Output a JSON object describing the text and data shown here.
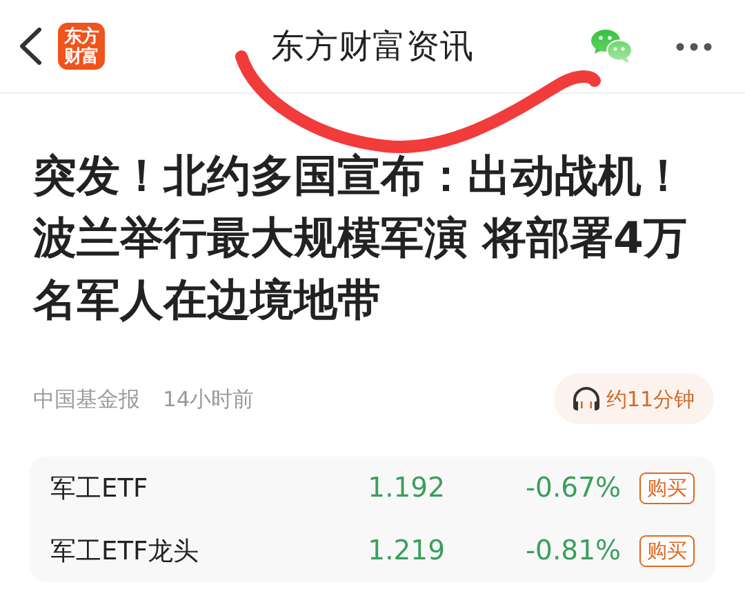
{
  "header": {
    "title": "东方财富资讯",
    "logo_lines": [
      "东方",
      "财富"
    ]
  },
  "article": {
    "headline": "突发！北约多国宣布：出动战机！波兰举行最大规模军演 将部署4万名军人在边境地带",
    "source": "中国基金报",
    "time": "14小时前",
    "listen": {
      "label": "约11分钟"
    }
  },
  "funds": [
    {
      "name": "军工ETF",
      "price": "1.192",
      "change": "-0.67%",
      "falling": true,
      "action": "购买"
    },
    {
      "name": "军工ETF龙头",
      "price": "1.219",
      "change": "-0.81%",
      "falling": true,
      "action": "购买"
    }
  ],
  "annotation": {
    "kind": "freehand-curve"
  }
}
